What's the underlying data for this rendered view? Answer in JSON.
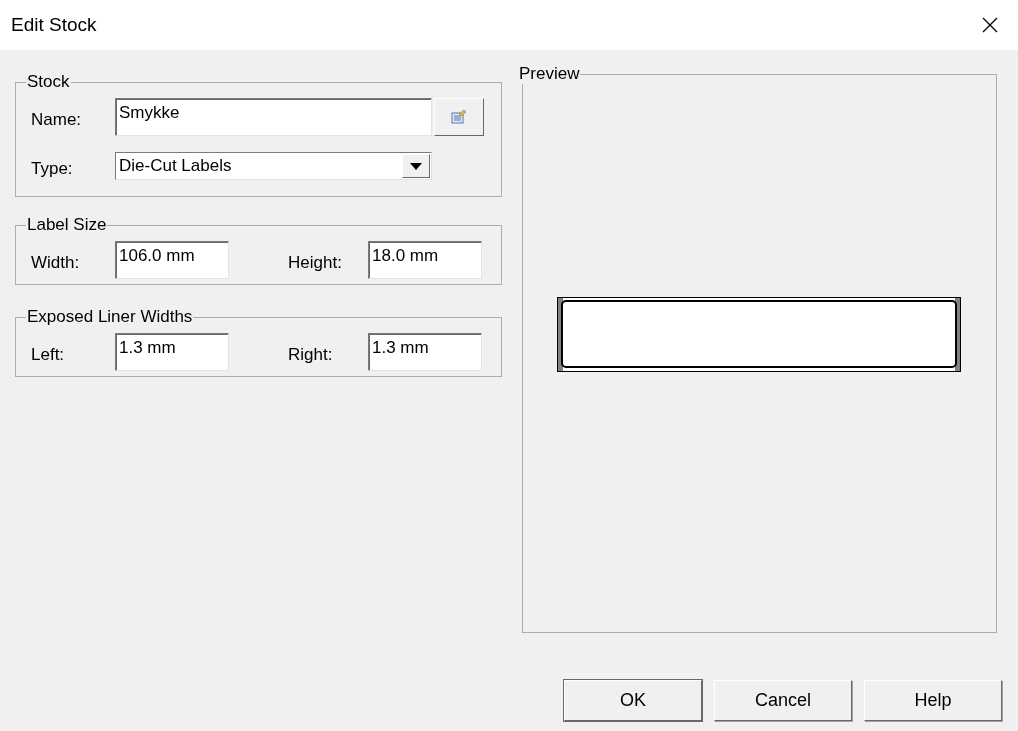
{
  "window": {
    "title": "Edit Stock"
  },
  "stock": {
    "legend": "Stock",
    "name_label": "Name:",
    "name_value": "Smykke",
    "type_label": "Type:",
    "type_value": "Die-Cut Labels"
  },
  "label_size": {
    "legend": "Label Size",
    "fields": [
      {
        "label": "Width:",
        "value": "106.0 mm"
      },
      {
        "label": "Height:",
        "value": "18.0 mm"
      }
    ]
  },
  "exposed_liner_widths": {
    "legend": "Exposed Liner Widths",
    "fields": [
      {
        "label": "Left:",
        "value": "1.3 mm"
      },
      {
        "label": "Right:",
        "value": "1.3 mm"
      }
    ]
  },
  "preview": {
    "legend": "Preview"
  },
  "buttons": [
    "OK",
    "Cancel",
    "Help"
  ]
}
